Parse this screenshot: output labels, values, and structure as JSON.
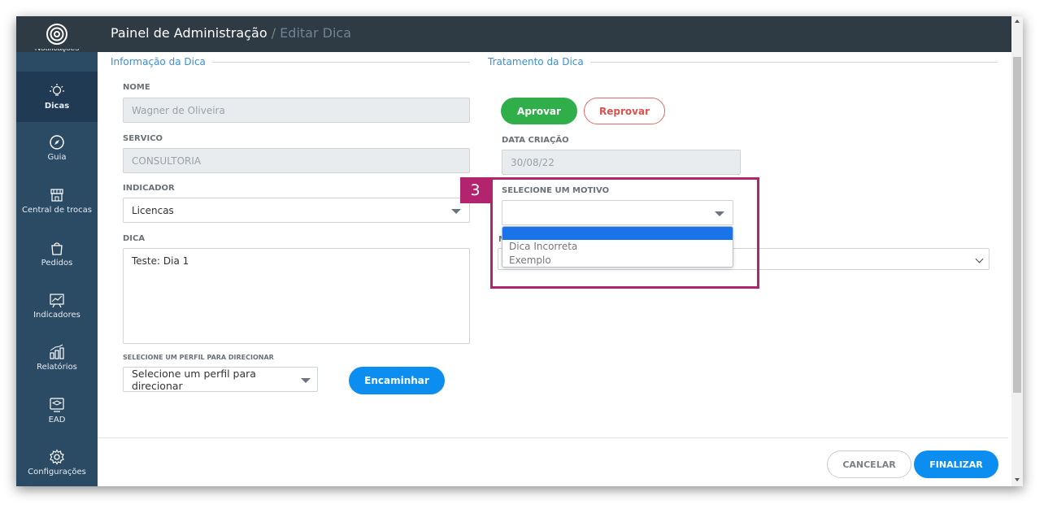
{
  "header": {
    "title": "Painel de Administração",
    "subtitle": "/ Editar Dica"
  },
  "sidebar": {
    "cut_label": "Notificações",
    "items": [
      {
        "label": "Dicas",
        "icon": "lightbulb-icon",
        "active": true
      },
      {
        "label": "Guia",
        "icon": "compass-icon"
      },
      {
        "label": "Central de trocas",
        "icon": "store-icon"
      },
      {
        "label": "Pedidos",
        "icon": "shopping-bag-icon"
      },
      {
        "label": "Indicadores",
        "icon": "chart-board-icon"
      },
      {
        "label": "Relatórios",
        "icon": "bar-report-icon"
      },
      {
        "label": "EAD",
        "icon": "graduation-screen-icon"
      },
      {
        "label": "Configurações",
        "icon": "gear-icon"
      }
    ]
  },
  "info_section": {
    "title": "Informação da Dica",
    "nome_label": "NOME",
    "nome_value": "Wagner de Oliveira",
    "servico_label": "SERVICO",
    "servico_value": "CONSULTORIA",
    "indicador_label": "INDICADOR",
    "indicador_value": "Licencas",
    "dica_label": "DICA",
    "dica_value": "Teste: Dia 1",
    "perfil_label": "SELECIONE UM PERFIL PARA DIRECIONAR",
    "perfil_value": "Selecione um perfil para direcionar",
    "encaminhar_label": "Encaminhar"
  },
  "treatment_section": {
    "title": "Tratamento da Dica",
    "aprovar_label": "Aprovar",
    "reprovar_label": "Reprovar",
    "data_label": "DATA CRIAÇÃO",
    "data_value": "30/08/22",
    "motivo_label": "SELECIONE UM MOTIVO",
    "motivo_value": "",
    "motivo_options": [
      "",
      "Dica Incorreta",
      "Exemplo"
    ],
    "hidden_label_fragment": "M"
  },
  "annotation": {
    "step_number": "3",
    "color": "#b2246e"
  },
  "footer": {
    "cancel_label": "CANCELAR",
    "finish_label": "FINALIZAR"
  },
  "colors": {
    "sidebar": "#2b4a63",
    "topbar": "#2e3a44",
    "accent_blue": "#0b8ef0",
    "approve_green": "#2fae49",
    "reject_red": "#d9534f"
  }
}
